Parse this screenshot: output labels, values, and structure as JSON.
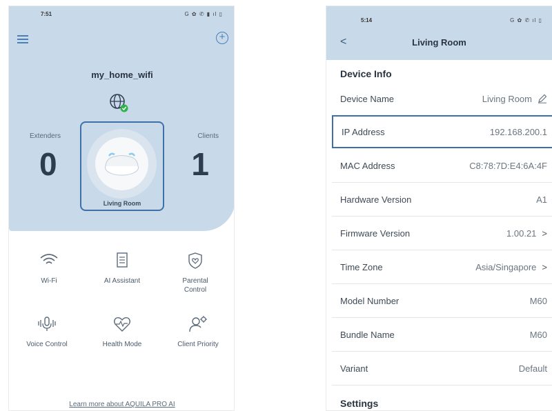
{
  "left_phone": {
    "status_time": "7:51",
    "status_icons": "G ✿ ✆ ▮ ıl ▯",
    "network_name": "my_home_wifi",
    "extenders_label": "Extenders",
    "extenders_count": "0",
    "clients_label": "Clients",
    "clients_count": "1",
    "device_label": "Living Room",
    "tiles": [
      {
        "label": "Wi-Fi",
        "icon": "wifi-icon"
      },
      {
        "label": "AI Assistant",
        "icon": "document-icon"
      },
      {
        "label": "Parental Control",
        "icon": "shield-heart-icon"
      },
      {
        "label": "Voice Control",
        "icon": "voice-icon"
      },
      {
        "label": "Health Mode",
        "icon": "heart-pulse-icon"
      },
      {
        "label": "Client Priority",
        "icon": "client-gear-icon"
      }
    ],
    "learn_more": "Learn more about AQUILA PRO AI",
    "accent_color": "#4a7fb5",
    "panel_color": "#c8d9ea"
  },
  "right_phone": {
    "status_time": "5:14",
    "status_icons": "G ✿ ✆ ıl ▯",
    "back_label": "<",
    "title": "Living Room",
    "device_info_title": "Device Info",
    "rows": [
      {
        "label": "Device Name",
        "value": "Living Room"
      },
      {
        "label": "IP Address",
        "value": "192.168.200.1"
      },
      {
        "label": "MAC Address",
        "value": "C8:78:7D:E4:6A:4F"
      },
      {
        "label": "Hardware Version",
        "value": "A1"
      },
      {
        "label": "Firmware Version",
        "value": "1.00.21"
      },
      {
        "label": "Time Zone",
        "value": "Asia/Singapore"
      },
      {
        "label": "Model Number",
        "value": "M60"
      },
      {
        "label": "Bundle Name",
        "value": "M60"
      },
      {
        "label": "Variant",
        "value": "Default"
      }
    ],
    "chevron": ">",
    "settings_title": "Settings",
    "highlight_color": "#3e6fa8"
  }
}
